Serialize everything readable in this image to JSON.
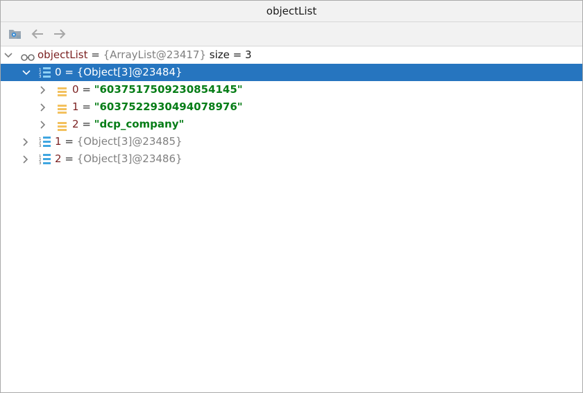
{
  "window": {
    "title": "objectList"
  },
  "toolbar": {
    "buttons": [
      {
        "id": "restore-layout",
        "icon": "folder-settings-icon"
      },
      {
        "id": "back",
        "icon": "arrow-left-icon"
      },
      {
        "id": "forward",
        "icon": "arrow-right-icon"
      }
    ]
  },
  "colors": {
    "selection": "#2675bf",
    "var_name": "#7a1f1f",
    "string_value": "#067d17",
    "type_gray": "#808080"
  },
  "tree": {
    "root": {
      "name": "objectList",
      "eq": " = ",
      "value": "{ArrayList@23417}",
      "size": " size = 3",
      "icon": "watch-glasses-icon"
    },
    "items": [
      {
        "name": "0",
        "eq": " = ",
        "value": "{Object[3]@23484}",
        "selected": true,
        "expanded": true,
        "children": [
          {
            "name": "0",
            "eq": " = ",
            "value": "\"6037517509230854145\""
          },
          {
            "name": "1",
            "eq": " = ",
            "value": "\"6037522930494078976\""
          },
          {
            "name": "2",
            "eq": " = ",
            "value": "\"dcp_company\""
          }
        ]
      },
      {
        "name": "1",
        "eq": " = ",
        "value": "{Object[3]@23485}",
        "selected": false,
        "expanded": false
      },
      {
        "name": "2",
        "eq": " = ",
        "value": "{Object[3]@23486}",
        "selected": false,
        "expanded": false
      }
    ]
  }
}
